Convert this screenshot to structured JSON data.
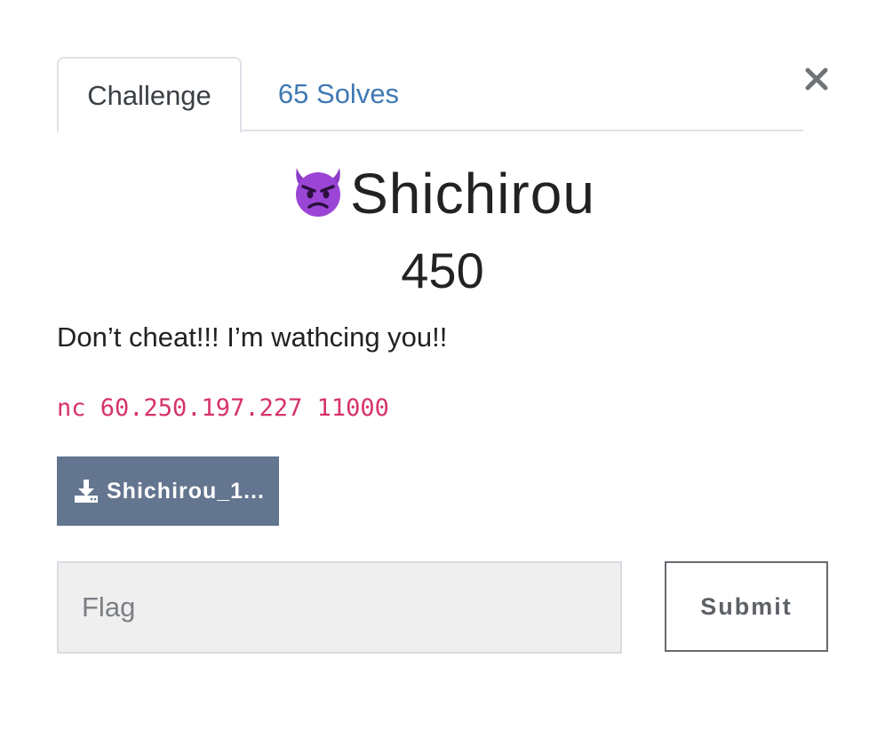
{
  "tabs": {
    "challenge_label": "Challenge",
    "solves_label": "65 Solves"
  },
  "close": {
    "icon": "close-icon",
    "glyph": "×"
  },
  "challenge": {
    "emoji_icon": "smiling-devil-emoji-icon",
    "name": "Shichirou",
    "points": "450",
    "description": "Don’t cheat!!! I’m wathcing you!!",
    "connection": "nc 60.250.197.227 11000"
  },
  "file": {
    "icon": "download-icon",
    "label": "Shichirou_1..."
  },
  "flag_form": {
    "placeholder": "Flag",
    "value": "",
    "submit_label": "Submit"
  },
  "colors": {
    "tab_link": "#3f79b4",
    "code_text": "#d6336c",
    "file_button_bg": "#63758f",
    "input_bg": "#efefef",
    "submit_border": "#666b70"
  }
}
